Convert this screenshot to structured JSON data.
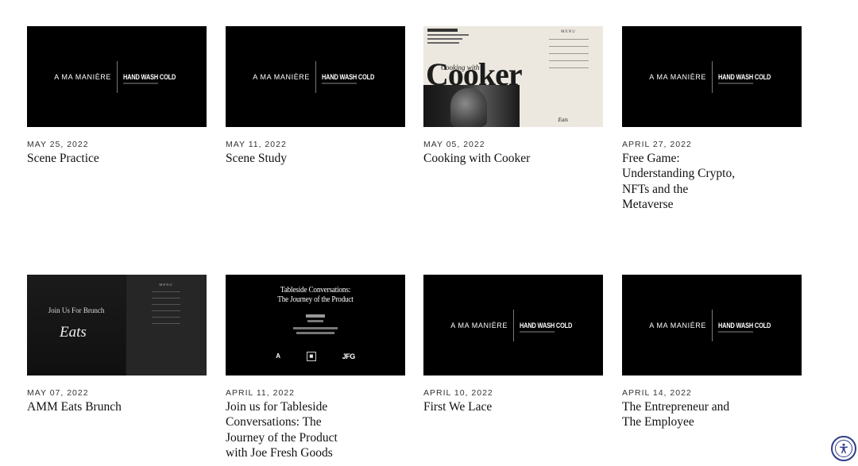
{
  "brand": {
    "left": "A MA MANIÈRE",
    "right": "HAND WASH COLD"
  },
  "posts": [
    {
      "date": "MAY 25, 2022",
      "title": "Scene Practice",
      "thumb": "brand"
    },
    {
      "date": "MAY 11, 2022",
      "title": "Scene Study",
      "thumb": "brand"
    },
    {
      "date": "MAY 05, 2022",
      "title": "Cooking with Cooker",
      "thumb": "cooker"
    },
    {
      "date": "APRIL 27, 2022",
      "title": "Free Game: Understanding Crypto, NFTs and the Metaverse",
      "thumb": "brand"
    },
    {
      "date": "MAY 07, 2022",
      "title": "AMM Eats Brunch",
      "thumb": "brunch"
    },
    {
      "date": "APRIL 11, 2022",
      "title": "Join us for Tableside Conversations: The Journey of the Product with Joe Fresh Goods",
      "thumb": "tableside"
    },
    {
      "date": "APRIL 10, 2022",
      "title": "First We Lace",
      "thumb": "brand"
    },
    {
      "date": "APRIL 14, 2022",
      "title": "The Entrepreneur and The Employee",
      "thumb": "brand"
    }
  ],
  "cooker_thumb": {
    "with": "Cooking with",
    "big": "Cooker",
    "menu_heading": "MENU",
    "eats": "Eats"
  },
  "brunch_thumb": {
    "join": "Join Us For Brunch",
    "eats": "Eats",
    "menu_heading": "MENU"
  },
  "tableside_thumb": {
    "line1": "Tableside Conversations:",
    "line2": "The Journey of the Product",
    "logo_a": "A",
    "logo_jfg": "JFG"
  },
  "icons": {
    "accessibility": "accessibility-icon"
  },
  "colors": {
    "a11y_ring": "#2f3d8a"
  }
}
